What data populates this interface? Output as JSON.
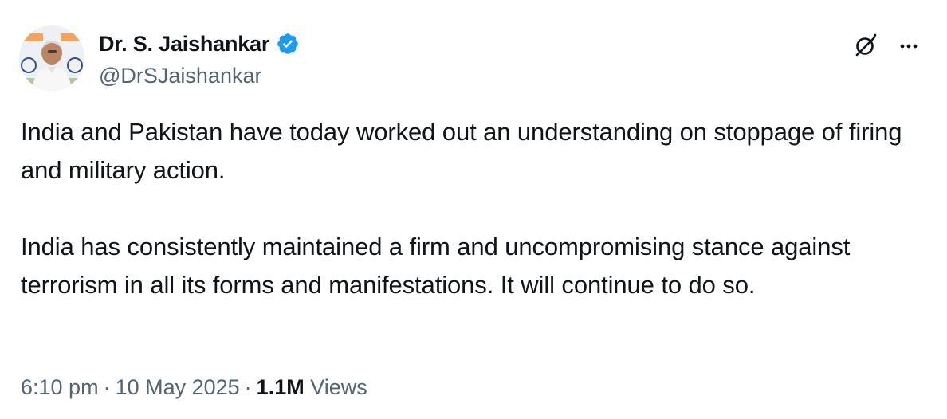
{
  "author": {
    "display_name": "Dr. S. Jaishankar",
    "handle": "@DrSJaishankar",
    "verified": true,
    "verified_color": "#1d9bf0"
  },
  "actions": {
    "grok_icon": "grok-icon",
    "more_icon": "more-options-icon"
  },
  "tweet": {
    "paragraphs": [
      "India and Pakistan have today worked out an understanding on stoppage of firing and military action.",
      "India has consistently maintained a firm and uncompromising stance against terrorism in all its forms and manifestations. It will continue to do so."
    ]
  },
  "meta": {
    "time": "6:10 pm",
    "separator": "·",
    "date": "10 May 2025",
    "views_count": "1.1M",
    "views_label": "Views"
  },
  "colors": {
    "text_primary": "#0f1419",
    "text_secondary": "#536471"
  }
}
